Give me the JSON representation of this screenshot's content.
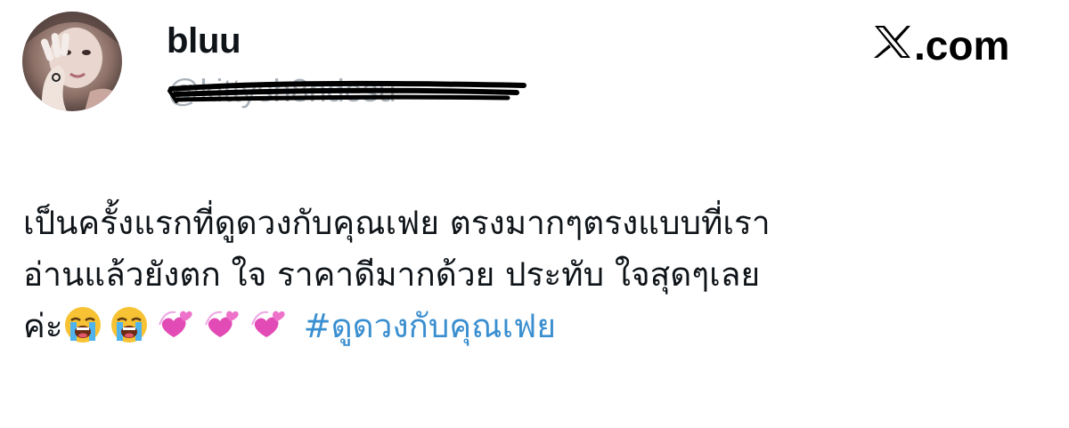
{
  "author": {
    "display_name": "bluu",
    "handle": "@kittysh8ndesu",
    "avatar_icon": "profile-photo"
  },
  "brand": {
    "logo_text": ".com",
    "logo_icon": "x-logo-icon"
  },
  "tweet": {
    "line1": "เป็นครั้งแรกที่ดูดวงกับคุณเฟย ตรงมากๆตรงแบบที่เรา",
    "line2": "อ่านแล้วยังตก ใจ ราคาดีมากด้วย ประทับ ใจสุดๆเลย",
    "line3_text": "ค่ะ",
    "emojis": [
      "loudly-crying-face",
      "loudly-crying-face",
      "revolving-hearts",
      "revolving-hearts",
      "revolving-hearts"
    ],
    "hashtag": "#ดูดวงกับคุณเฟย"
  },
  "colors": {
    "text": "#0f1419",
    "handle": "#a9b1b9",
    "hashtag": "#3a8fd0",
    "background": "#ffffff"
  }
}
